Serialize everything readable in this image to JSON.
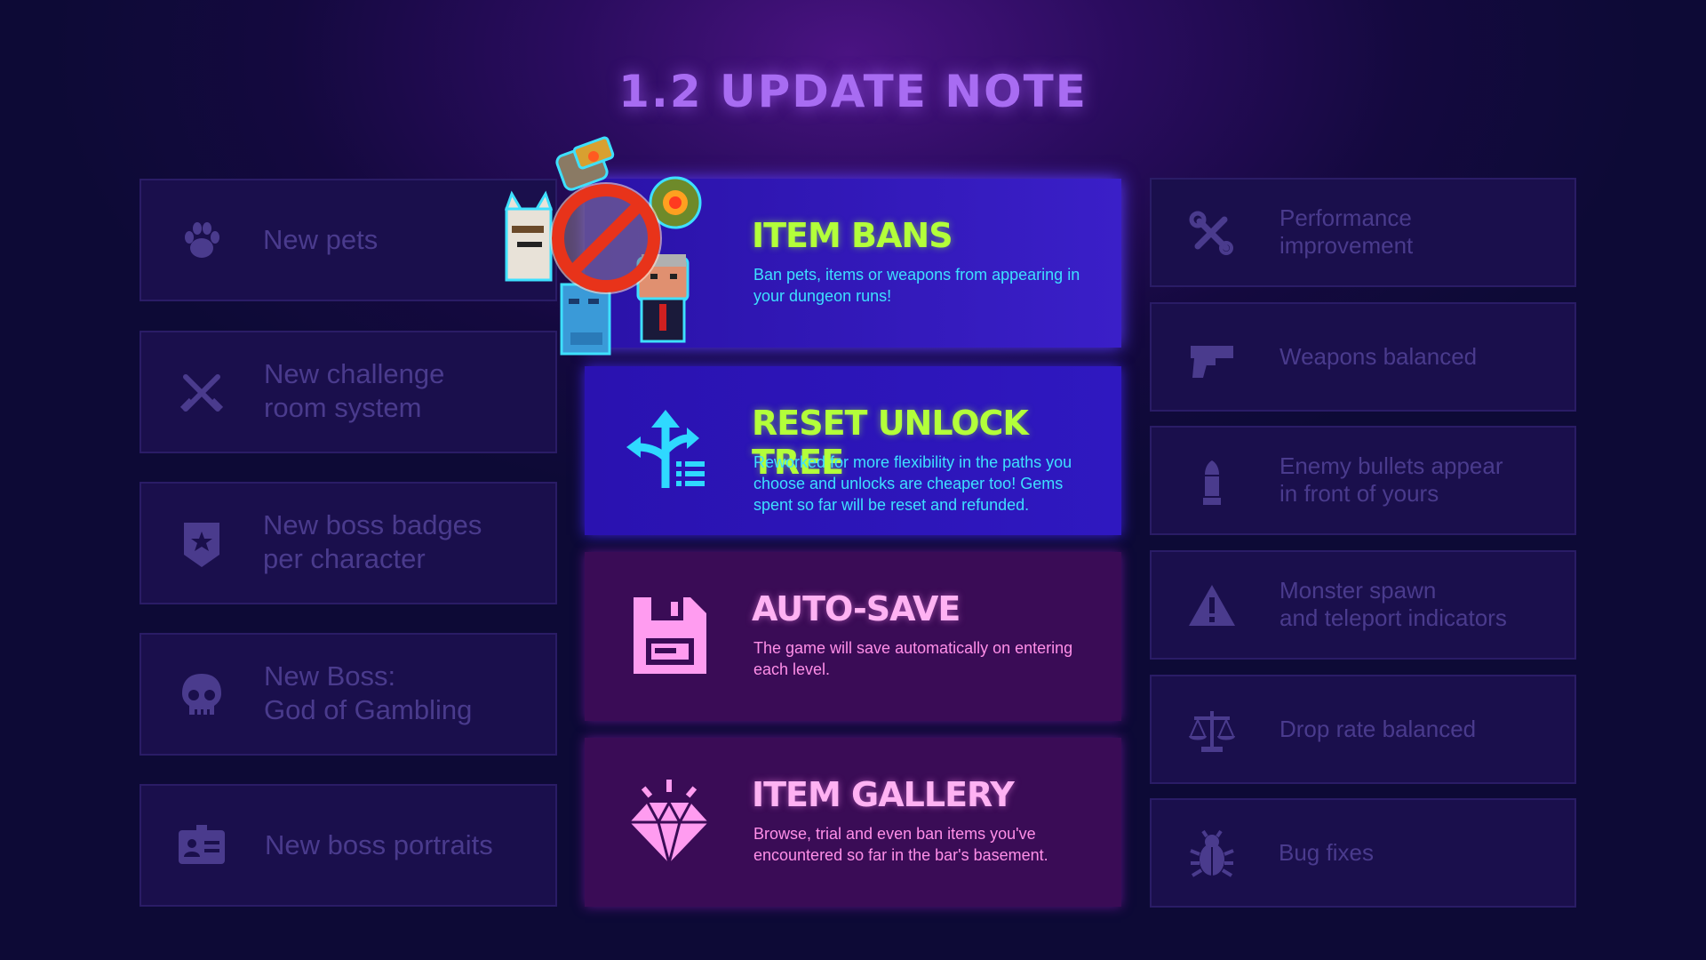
{
  "title": "1.2 UPDATE NOTE",
  "left_items": [
    {
      "icon": "paw-icon",
      "label": "New  pets"
    },
    {
      "icon": "crossed-swords-icon",
      "label": "New challenge\nroom system"
    },
    {
      "icon": "badge-icon",
      "label": "New boss badges\nper character"
    },
    {
      "icon": "skull-icon",
      "label": "New Boss:\nGod of Gambling"
    },
    {
      "icon": "id-card-icon",
      "label": "New boss portraits"
    }
  ],
  "features": [
    {
      "icon": "ban-icon",
      "title": "ITEM BANS",
      "desc": "Ban pets, items or weapons from appearing in your dungeon runs!"
    },
    {
      "icon": "branch-arrows-icon",
      "title": "RESET UNLOCK TREE",
      "desc": "Reworked for more flexibility in the paths you choose and unlocks are cheaper too! Gems spent so far will be reset and refunded."
    },
    {
      "icon": "floppy-disk-icon",
      "title": "AUTO-SAVE",
      "desc": "The game will save automatically on entering each level."
    },
    {
      "icon": "diamond-icon",
      "title": "ITEM GALLERY",
      "desc": "Browse, trial and even ban items you've encountered so far in the bar's basement."
    }
  ],
  "right_items": [
    {
      "icon": "tools-icon",
      "label": "Performance\nimprovement"
    },
    {
      "icon": "pistol-icon",
      "label": "Weapons balanced"
    },
    {
      "icon": "bullet-icon",
      "label": "Enemy bullets appear\nin front of yours"
    },
    {
      "icon": "warning-icon",
      "label": "Monster spawn\nand teleport indicators"
    },
    {
      "icon": "scales-icon",
      "label": "Drop rate balanced"
    },
    {
      "icon": "bug-icon",
      "label": "Bug fixes"
    }
  ],
  "colors": {
    "feature_title_blue": "#b3ff3a",
    "feature_title_purple": "#ffb2f3",
    "muted": "#4a3b8d"
  }
}
